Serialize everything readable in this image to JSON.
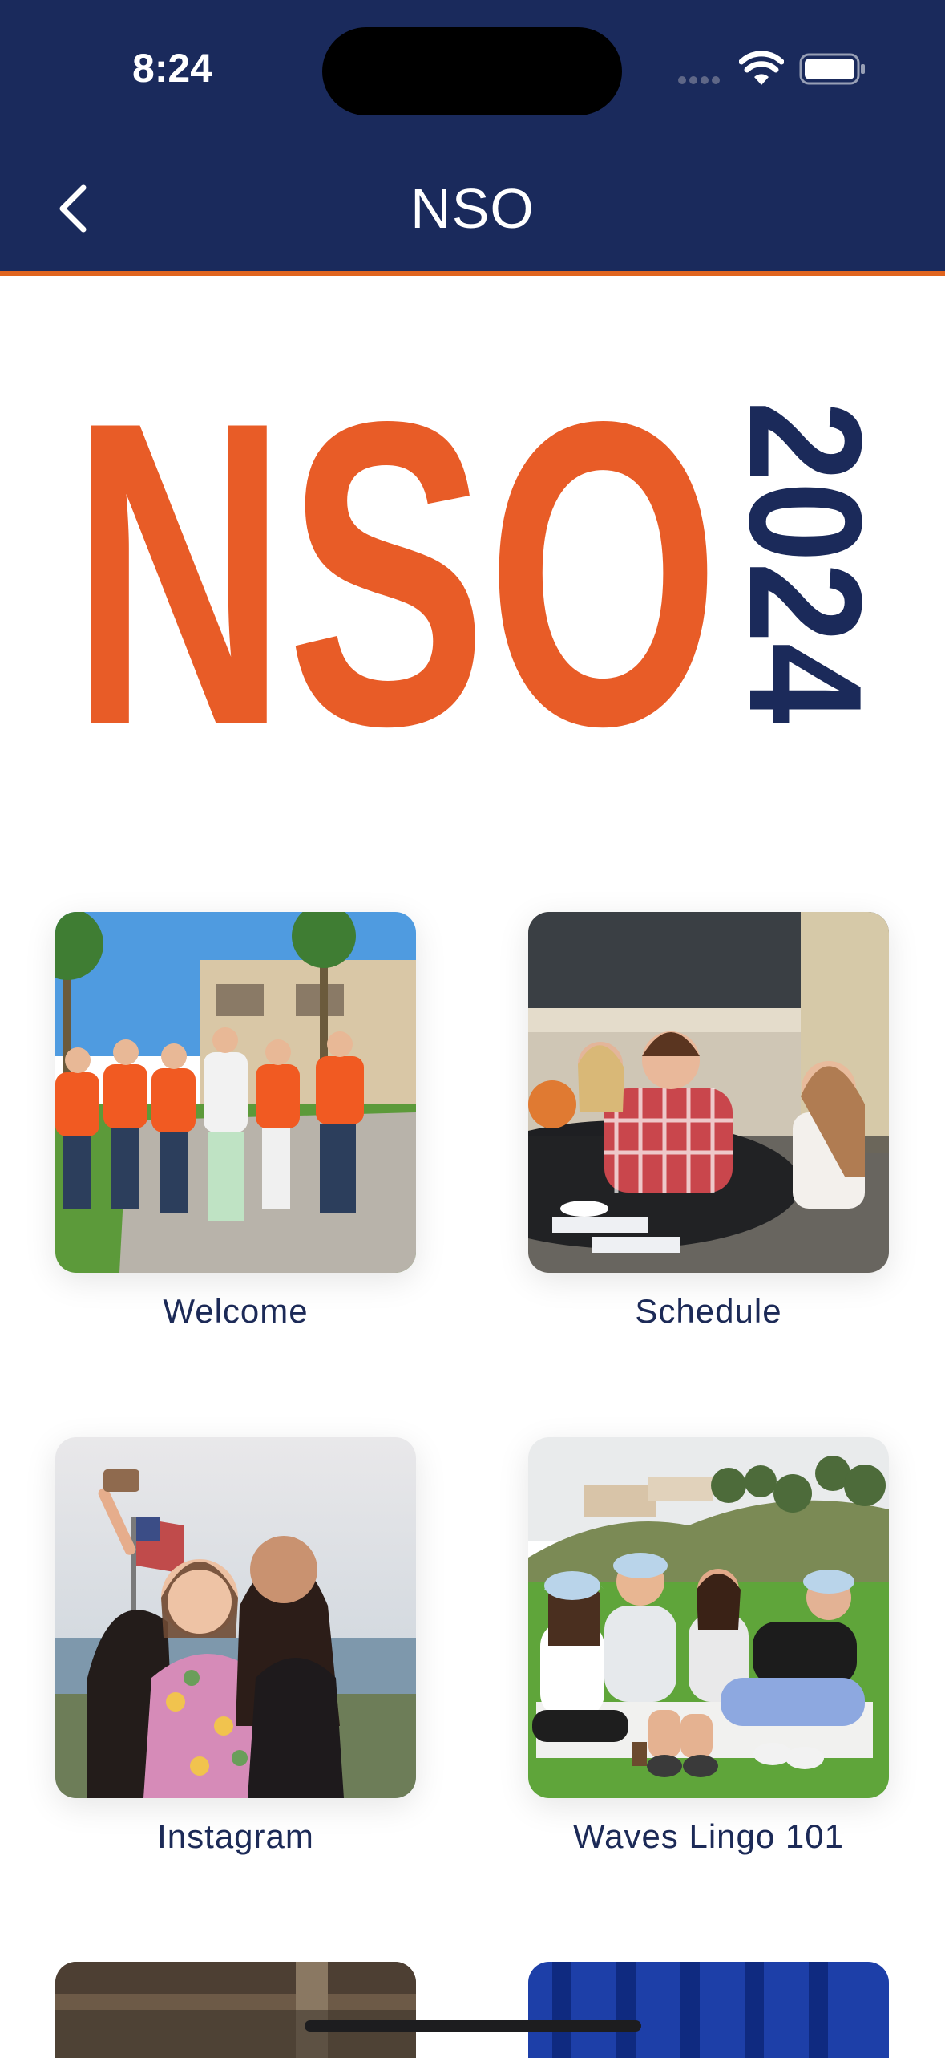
{
  "status_bar": {
    "time": "8:24"
  },
  "nav": {
    "title": "NSO"
  },
  "logo": {
    "text": "NSO",
    "year": "2024"
  },
  "tiles": [
    {
      "label": "Welcome"
    },
    {
      "label": "Schedule"
    },
    {
      "label": "Instagram"
    },
    {
      "label": "Waves Lingo 101"
    }
  ],
  "colors": {
    "header_bg": "#1a2a5c",
    "accent_orange": "#e0641e",
    "logo_orange": "#e85c27",
    "logo_navy": "#1b2a5a",
    "label_text": "#1c2a57"
  }
}
